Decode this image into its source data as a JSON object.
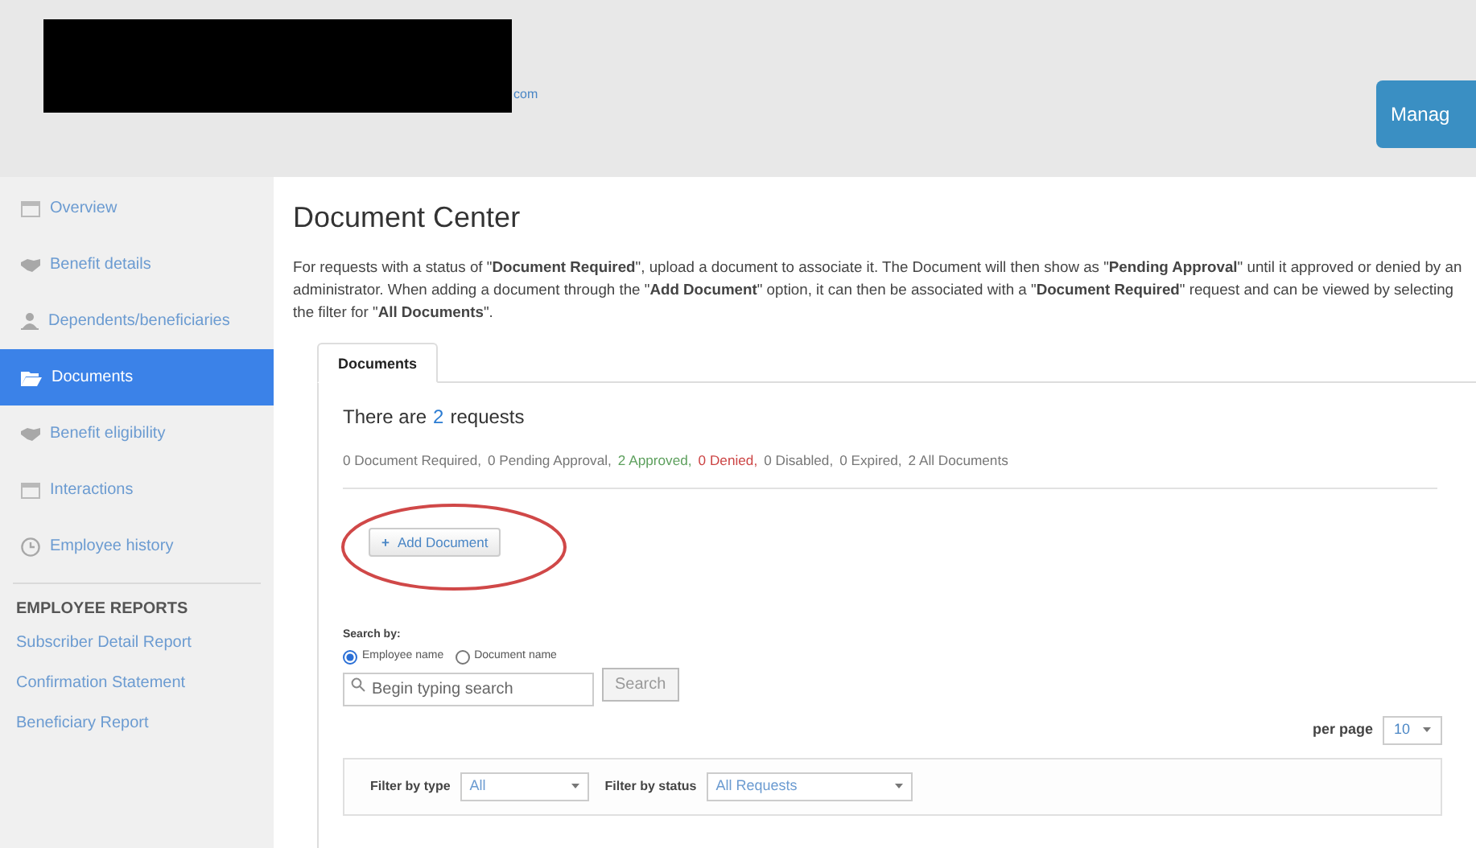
{
  "header": {
    "domain_fragment": "com",
    "manage_button": "Manag"
  },
  "sidebar": {
    "items": [
      {
        "label": "Overview",
        "selected": false
      },
      {
        "label": "Benefit details",
        "selected": false
      },
      {
        "label": "Dependents/beneficiaries",
        "selected": false
      },
      {
        "label": "Documents",
        "selected": true
      },
      {
        "label": "Benefit eligibility",
        "selected": false
      },
      {
        "label": "Interactions",
        "selected": false
      },
      {
        "label": "Employee history",
        "selected": false
      }
    ],
    "reports_heading": "EMPLOYEE REPORTS",
    "reports": [
      "Subscriber Detail Report",
      "Confirmation Statement",
      "Beneficiary Report"
    ]
  },
  "page_title": "Document Center",
  "description": "For requests with a status of \"**Document Required**\", upload a document to associate it. The Document will then show as \"**Pending Approval**\" until it approved or denied by an administrator. When adding a document through the \"**Add Document**\" option, it can then be associated with a \"**Document Required**\" request and can be viewed by selecting the filter for \"**All Documents**\".",
  "tabs": [
    {
      "label": "Documents",
      "selected": true
    }
  ],
  "summary": {
    "prefix": "There are",
    "count": "2",
    "suffix": "requests"
  },
  "status_counts": [
    {
      "text": "0 Document Required,",
      "kind": "neutral"
    },
    {
      "text": "0 Pending Approval,",
      "kind": "neutral"
    },
    {
      "text": "2 Approved,",
      "kind": "approved"
    },
    {
      "text": "0 Denied,",
      "kind": "denied"
    },
    {
      "text": "0 Disabled,",
      "kind": "neutral"
    },
    {
      "text": "0 Expired,",
      "kind": "neutral"
    },
    {
      "text": "2 All Documents",
      "kind": "neutral"
    }
  ],
  "add_button": {
    "icon": "+",
    "label": "Add Document"
  },
  "search": {
    "label": "Search by:",
    "options": [
      {
        "label": "Employee name",
        "selected": true
      },
      {
        "label": "Document name",
        "selected": false
      }
    ],
    "placeholder": "Begin typing search",
    "button": "Search"
  },
  "per_page": {
    "label": "per page",
    "value": "10"
  },
  "filters": [
    {
      "label": "Filter by type",
      "value": "All"
    },
    {
      "label": "Filter by status",
      "value": "All Requests"
    }
  ]
}
